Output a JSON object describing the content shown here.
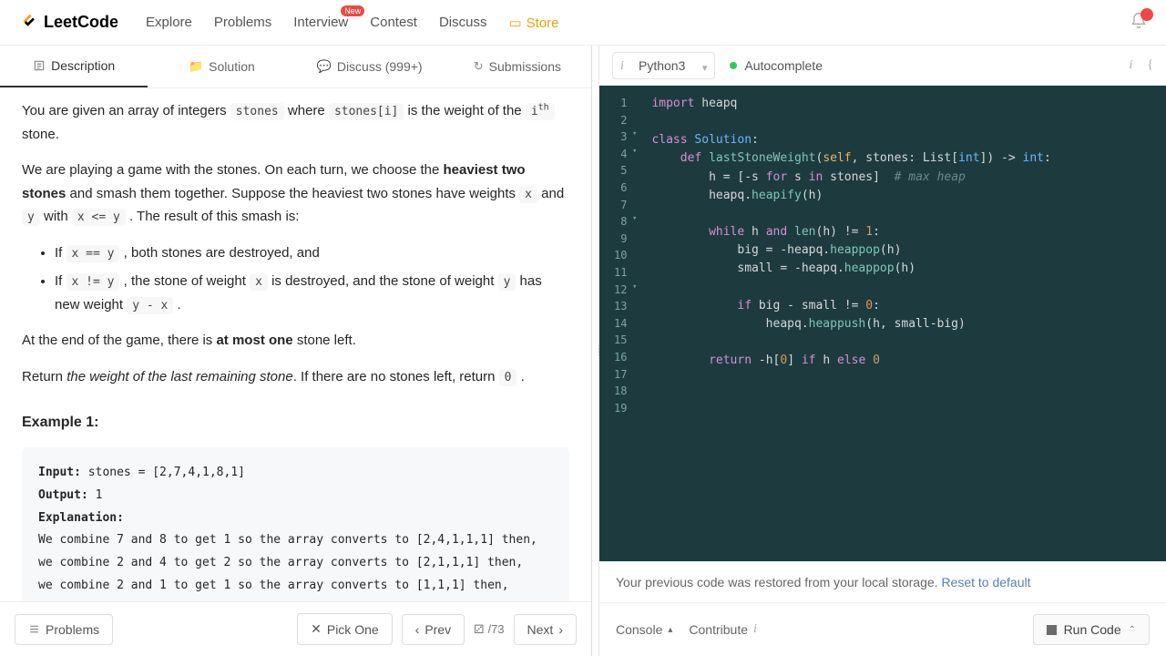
{
  "header": {
    "brand": "LeetCode",
    "nav": {
      "explore": "Explore",
      "problems": "Problems",
      "interview": "Interview",
      "interview_badge": "New",
      "contest": "Contest",
      "discuss": "Discuss",
      "store": "Store"
    }
  },
  "left_tabs": {
    "description": "Description",
    "solution": "Solution",
    "discuss": "Discuss (999+)",
    "submissions": "Submissions"
  },
  "problem": {
    "intro_1": "You are given an array of integers ",
    "code_stones": "stones",
    "intro_2": " where ",
    "code_stonesi": "stones[i]",
    "intro_3": " is the weight of the ",
    "code_i": "i",
    "code_th": "th",
    "intro_4": " stone.",
    "p2a": "We are playing a game with the stones. On each turn, we choose the ",
    "p2b": "heaviest two stones",
    "p2c": " and smash them together. Suppose the heaviest two stones have weights ",
    "code_x": "x",
    "p2d": " and ",
    "code_y": "y",
    "p2e": " with ",
    "code_xley": "x <= y",
    "p2f": " . The result of this smash is:",
    "li1a": "If ",
    "code_xeqy": "x == y",
    "li1b": " , both stones are destroyed, and",
    "li2a": "If ",
    "code_xney": "x != y",
    "li2b": " , the stone of weight ",
    "li2c": " is destroyed, and the stone of weight ",
    "li2d": " has new weight ",
    "code_yminx": "y - x",
    "li2e": " .",
    "p3a": "At the end of the game, there is ",
    "p3b": "at most one",
    "p3c": " stone left.",
    "p4a": "Return ",
    "p4b": "the weight of the last remaining stone",
    "p4c": ". If there are no stones left, return ",
    "code_zero": "0",
    "p4d": " .",
    "example_h": "Example 1:",
    "example_block": "Input: stones = [2,7,4,1,8,1]\nOutput: 1\nExplanation:\nWe combine 7 and 8 to get 1 so the array converts to [2,4,1,1,1] then,\nwe combine 2 and 4 to get 2 so the array converts to [2,1,1,1] then,\nwe combine 2 and 1 to get 1 so the array converts to [1,1,1] then,",
    "ex_input_k": "Input:",
    "ex_input_v": " stones = [2,7,4,1,8,1]",
    "ex_output_k": "Output:",
    "ex_output_v": " 1",
    "ex_expl_k": "Explanation:",
    "ex_l1": "We combine 7 and 8 to get 1 so the array converts to [2,4,1,1,1] then,",
    "ex_l2": "we combine 2 and 4 to get 2 so the array converts to [2,1,1,1] then,",
    "ex_l3": "we combine 2 and 1 to get 1 so the array converts to [1,1,1] then,"
  },
  "left_bottom": {
    "problems": "Problems",
    "pick_one": "Pick One",
    "prev": "Prev",
    "page_total": "/73",
    "next": "Next"
  },
  "right_top": {
    "lang": "Python3",
    "autocomplete": "Autocomplete"
  },
  "editor": {
    "lines": [
      {
        "n": 1
      },
      {
        "n": 2
      },
      {
        "n": 3,
        "fold": true
      },
      {
        "n": 4,
        "fold": true
      },
      {
        "n": 5
      },
      {
        "n": 6
      },
      {
        "n": 7
      },
      {
        "n": 8,
        "fold": true
      },
      {
        "n": 9
      },
      {
        "n": 10
      },
      {
        "n": 11
      },
      {
        "n": 12,
        "fold": true
      },
      {
        "n": 13
      },
      {
        "n": 14
      },
      {
        "n": 15
      },
      {
        "n": 16
      },
      {
        "n": 17
      },
      {
        "n": 18
      },
      {
        "n": 19
      }
    ],
    "t": {
      "import": "import",
      "heapq": "heapq",
      "class": "class",
      "Solution": "Solution",
      "def": "def",
      "lastStoneWeight": "lastStoneWeight",
      "self": "self",
      "stones": "stones",
      "List": "List",
      "int": "int",
      "hassign": "h = [-s ",
      "for": "for",
      "sinstones": " s ",
      "in": "in",
      "stonesb": " stones]  ",
      "maxheap": "# max heap",
      "heapify": "heapq.",
      "heapifyfn": "heapify",
      "hpar": "(h)",
      "while": "while",
      "hand": " h ",
      "and": "and",
      "len": "len",
      "htail": "(h) != ",
      "one": "1",
      "col": ":",
      "bigass": "big = -heapq.",
      "heappop": "heappop",
      "smallass": "small = -heapq.",
      "if": "if",
      "bigsmall": " big - small != ",
      "zero": "0",
      "heappush": "heappush",
      "pushargs": "(h, small-big)",
      "return": "return",
      "rettail": " -h[",
      "rbrace": "] ",
      "ifk": "if",
      "helse": " h ",
      "else": "else",
      " ": " "
    }
  },
  "notice": {
    "msg": "Your previous code was restored from your local storage.  ",
    "link": "Reset to default"
  },
  "right_bottom": {
    "console": "Console",
    "contribute": "Contribute",
    "run": "Run Code"
  }
}
